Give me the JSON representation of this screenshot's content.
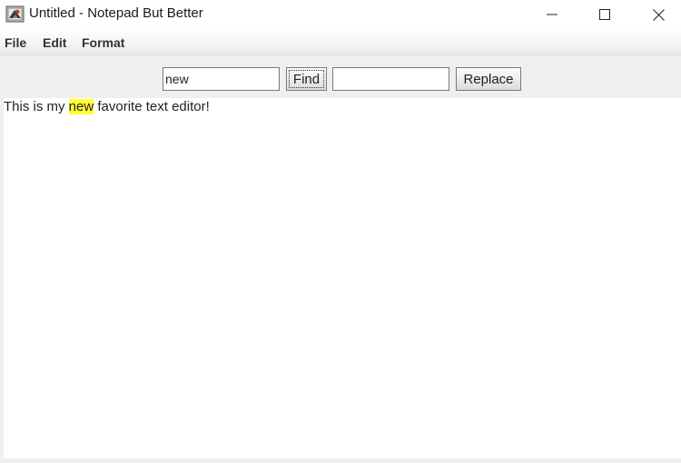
{
  "window": {
    "title": "Untitled - Notepad But Better"
  },
  "menu": {
    "file": "File",
    "edit": "Edit",
    "format": "Format"
  },
  "toolbar": {
    "find_value": "new",
    "find_label": "Find",
    "replace_value": "",
    "replace_label": "Replace"
  },
  "editor": {
    "text_before": "This is my ",
    "text_match": "new",
    "text_after": " favorite text editor!"
  },
  "icons": {
    "app": "app-icon",
    "minimize": "minimize-icon",
    "maximize": "maximize-icon",
    "close": "close-icon"
  },
  "colors": {
    "highlight": "#ffff33"
  }
}
